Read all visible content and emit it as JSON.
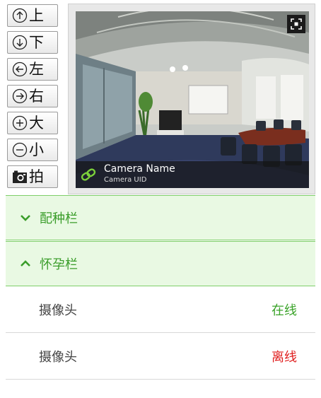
{
  "controls": [
    {
      "label": "上",
      "icon": "arrow-up-circle-icon"
    },
    {
      "label": "下",
      "icon": "arrow-down-circle-icon"
    },
    {
      "label": "左",
      "icon": "arrow-left-circle-icon"
    },
    {
      "label": "右",
      "icon": "arrow-right-circle-icon"
    },
    {
      "label": "大",
      "icon": "plus-circle-icon"
    },
    {
      "label": "小",
      "icon": "minus-circle-icon"
    },
    {
      "label": "拍",
      "icon": "camera-icon"
    }
  ],
  "camera": {
    "name": "Camera Name",
    "uid": "Camera UID",
    "link_icon": "link-icon",
    "fullscreen_icon": "fullscreen-icon"
  },
  "groups": [
    {
      "title": "配种栏",
      "state": "collapsed",
      "icon": "chevron-down-icon"
    },
    {
      "title": "怀孕栏",
      "state": "expanded",
      "icon": "chevron-up-icon"
    }
  ],
  "cameras": [
    {
      "name": "摄像头",
      "status": "在线"
    },
    {
      "name": "摄像头",
      "status": "离线"
    }
  ],
  "colors": {
    "online": "#3aa329",
    "offline": "#e02020",
    "accent_green": "#3a9d2a",
    "group_bg": "#e9f9e3"
  }
}
